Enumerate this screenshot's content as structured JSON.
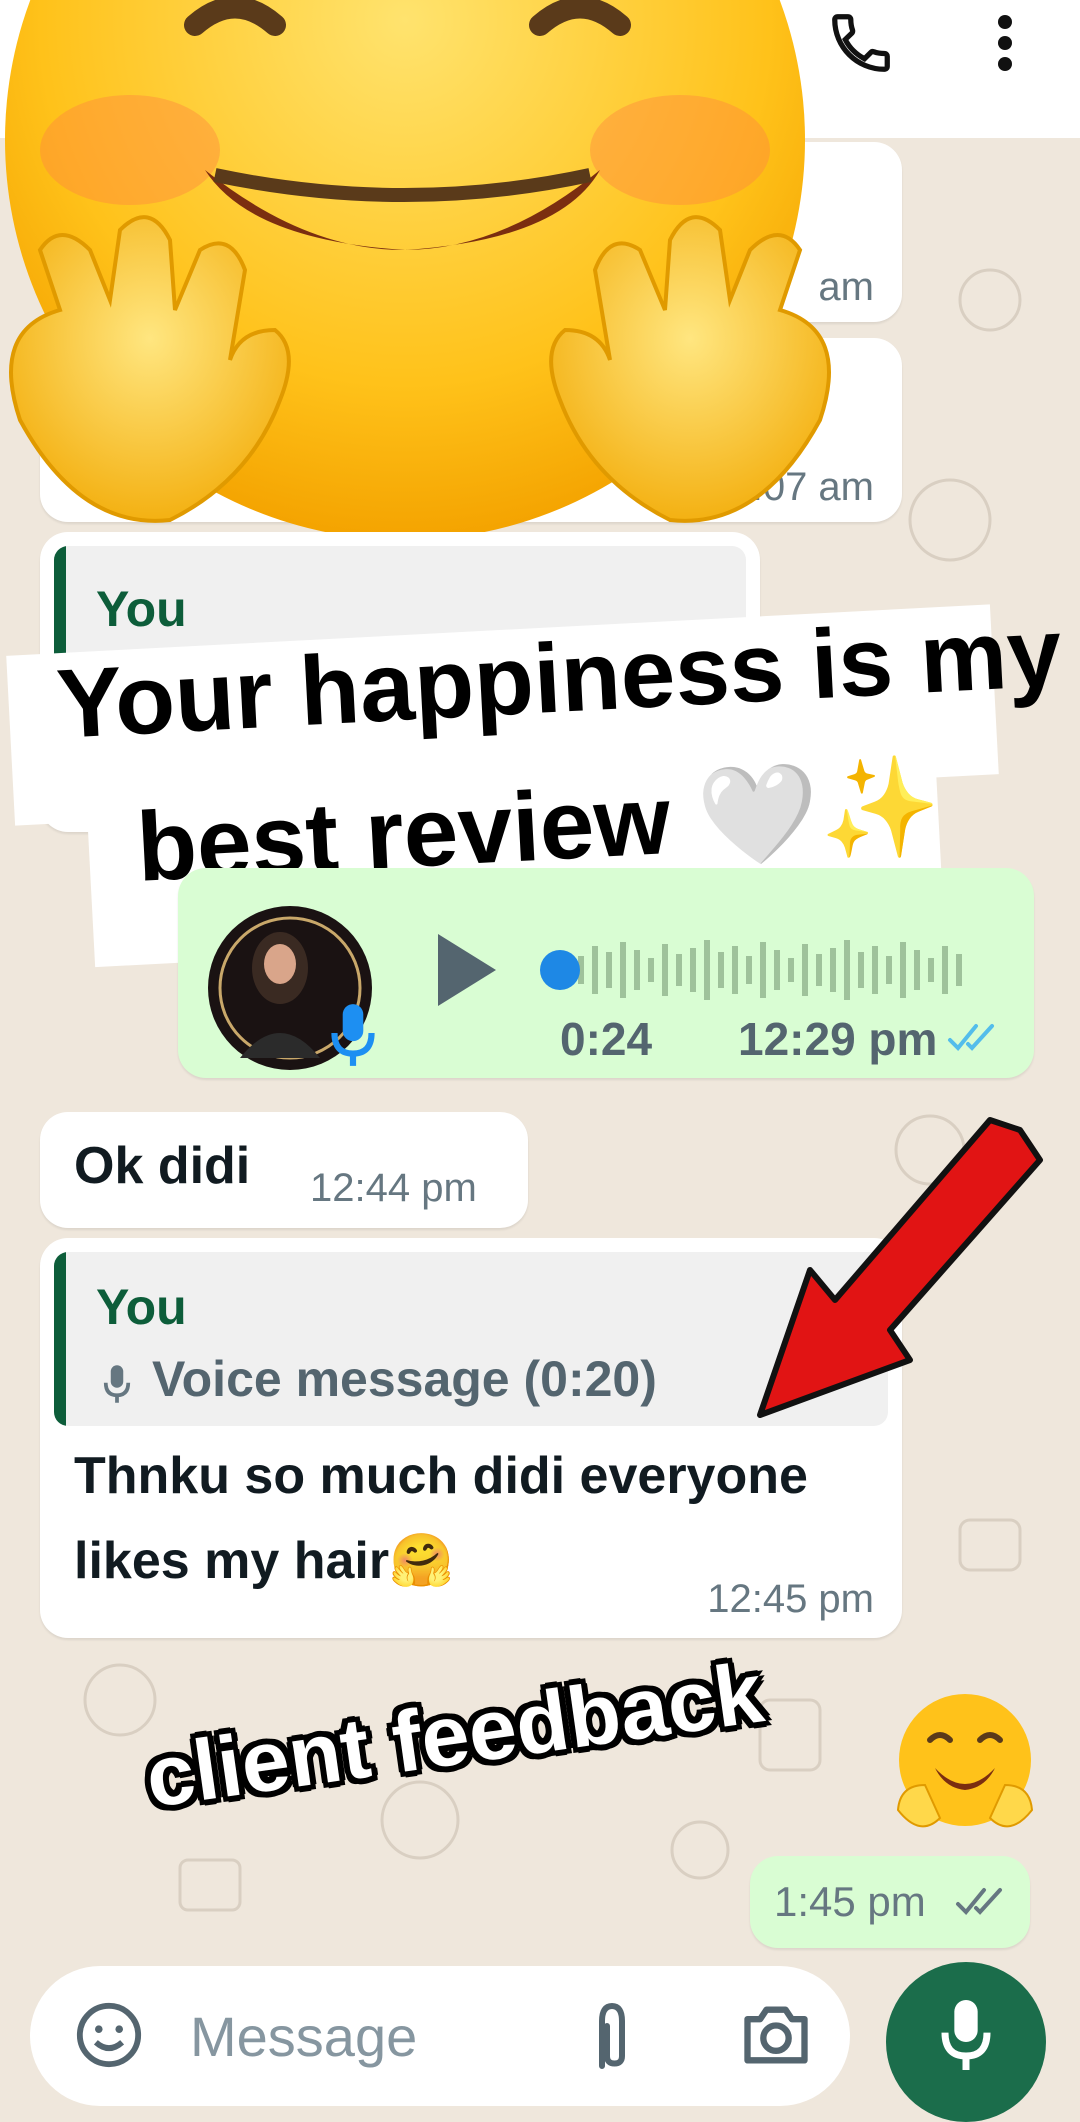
{
  "header": {
    "call_icon": "phone-icon",
    "menu_icon": "more-vertical-icon"
  },
  "messages": {
    "m1_time": "am",
    "m2_time": "1:07 am",
    "m3_quote_name": "You",
    "voice": {
      "duration": "0:24",
      "time": "12:29 pm",
      "progress": 0.0
    },
    "m5_text": "Ok didi",
    "m5_time": "12:44 pm",
    "m6_quote_name": "You",
    "m6_quote_text": "Voice message (0:20)",
    "m6_line1": "Thnku so much didi everyone",
    "m6_line2": "likes my hair🤗",
    "m6_time": "12:45 pm",
    "m7_time": "1:45 pm"
  },
  "overlays": {
    "headline_line1": "Your happiness is my",
    "headline_line2": "best review 🤍✨",
    "sticker_caption": "client feedback"
  },
  "input": {
    "placeholder": "Message"
  },
  "colors": {
    "accent": "#1b6d4b",
    "outgoing_bubble": "#d9fdd3",
    "read_tick": "#53bdeb",
    "arrow": "#e11414"
  }
}
